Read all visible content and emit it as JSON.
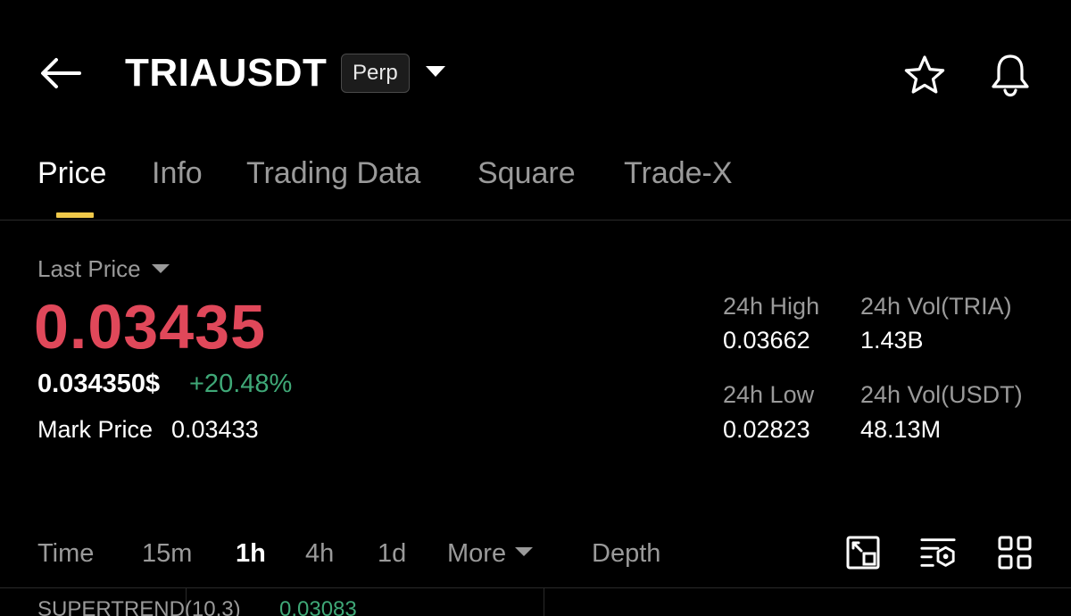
{
  "header": {
    "symbol": "TRIAUSDT",
    "badge": "Perp"
  },
  "icons": {
    "back": "arrow-left-icon",
    "dropdown": "caret-down-icon",
    "favorite": "star-icon",
    "alert": "bell-icon",
    "fullscreen": "fullscreen-chart-icon",
    "indicators": "indicator-settings-icon",
    "layout": "grid-layout-icon"
  },
  "tabs": [
    {
      "label": "Price",
      "active": true
    },
    {
      "label": "Info",
      "active": false
    },
    {
      "label": "Trading Data",
      "active": false
    },
    {
      "label": "Square",
      "active": false
    },
    {
      "label": "Trade-X",
      "active": false
    }
  ],
  "price": {
    "last_price_label": "Last Price",
    "last_price": "0.03435",
    "usd_price": "0.034350$",
    "change_pct": "+20.48%",
    "mark_price_label": "Mark Price",
    "mark_price": "0.03433"
  },
  "stats": {
    "high_label": "24h High",
    "high_value": "0.03662",
    "vol_tria_label": "24h Vol(TRIA)",
    "vol_tria_value": "1.43B",
    "low_label": "24h Low",
    "low_value": "0.02823",
    "vol_usdt_label": "24h Vol(USDT)",
    "vol_usdt_value": "48.13M"
  },
  "intervals": [
    {
      "label": "Time",
      "active": false
    },
    {
      "label": "15m",
      "active": false
    },
    {
      "label": "1h",
      "active": true
    },
    {
      "label": "4h",
      "active": false
    },
    {
      "label": "1d",
      "active": false
    },
    {
      "label": "More",
      "active": false
    },
    {
      "label": "Depth",
      "active": false
    }
  ],
  "indicator": {
    "label": "SUPERTREND(10,3)",
    "value": "0.03083"
  },
  "colors": {
    "price_down_red": "#e0485a",
    "change_green": "#3fa877",
    "tab_indicator": "#f0c94a",
    "muted_text": "#9a9a9a"
  }
}
